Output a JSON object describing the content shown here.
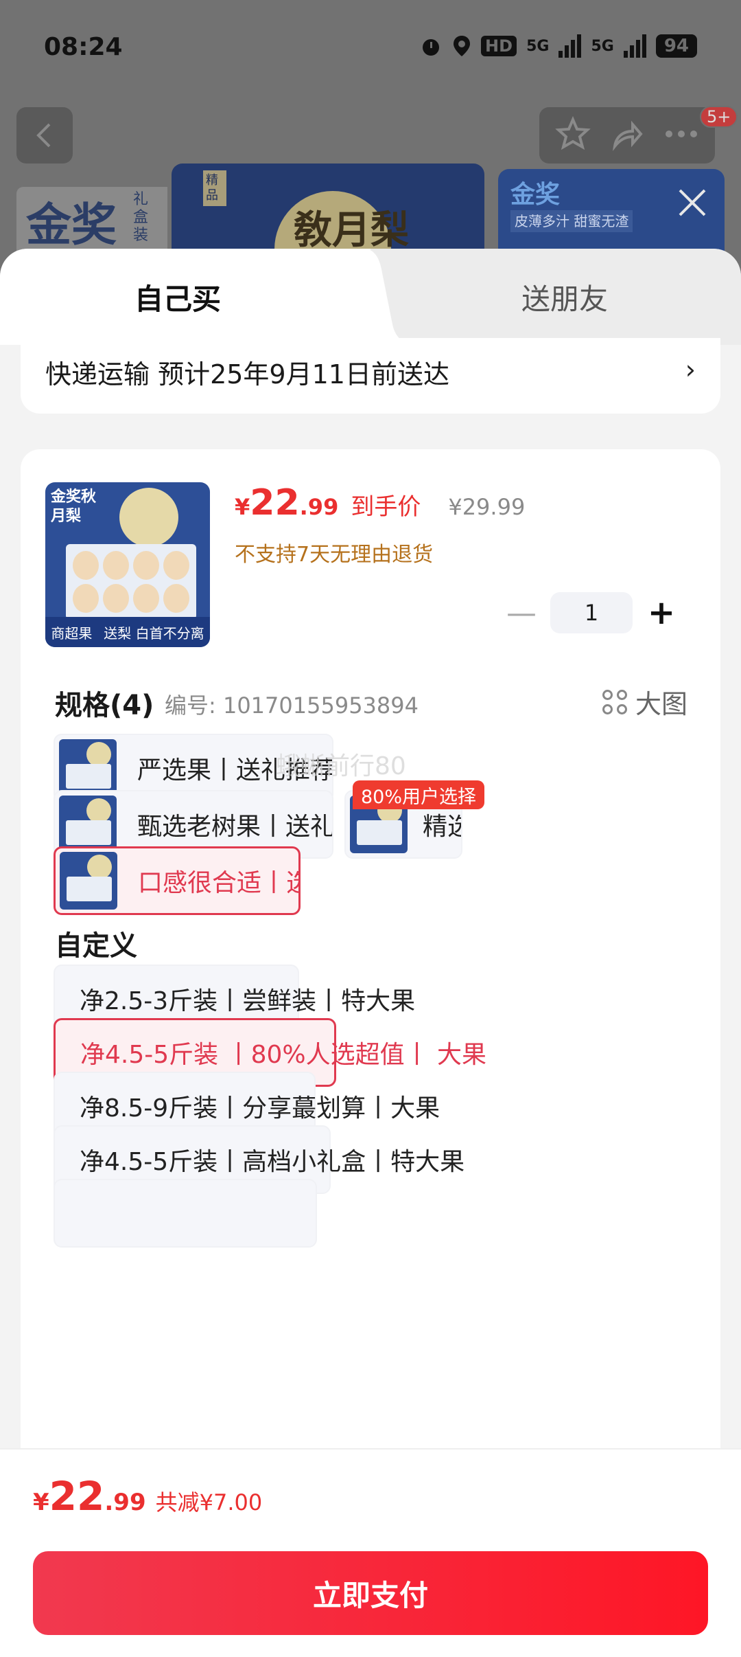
{
  "status_bar": {
    "time": "08:24",
    "hd": "HD",
    "net1": "5G",
    "net2": "5G",
    "battery": "94"
  },
  "header": {
    "badge": "5+"
  },
  "banner": {
    "left_title": "金奖",
    "left_sub": "礼盒装",
    "mid_title": "敎月梨",
    "mid_vert": "精品",
    "right_title": "金奖",
    "right_sub": "皮薄多汁 甜蜜无渣"
  },
  "tabs": [
    {
      "label": "自己买"
    },
    {
      "label": "送朋友"
    }
  ],
  "shipping": {
    "text": "快递运输 预计25年9月11日前送达",
    "arrow": "›"
  },
  "product": {
    "thumb_title": "金奖秋月梨",
    "thumb_bottom_left": "商超果",
    "thumb_bottom_right": "送梨 白首不分离",
    "currency": "¥",
    "price_int": "22",
    "price_dec": ".99",
    "price_label": "到手价",
    "original_price": "¥29.99",
    "return_policy": "不支持7天无理由退货",
    "quantity": "1",
    "minus": "—",
    "plus": "+"
  },
  "spec": {
    "title": "规格(4)",
    "code": "编号: 10170155953894",
    "bigpic": "大图",
    "watermark": "蛾蜥前行80",
    "popular_badge": "80%用户选择",
    "options": [
      {
        "label": "严选果丨送礼推荐礼盒装丨甜"
      },
      {
        "label": "甄选老树果丨送礼推荐礼盒装"
      },
      {
        "label": "精选果"
      },
      {
        "label": "口感很合适丨选购人最多"
      }
    ]
  },
  "custom": {
    "title": "自定义",
    "options": [
      {
        "label": "净2.5-3斤装丨尝鲜装丨特大果"
      },
      {
        "label": "净4.5-5斤装 丨80%人选超值丨 大果"
      },
      {
        "label": "净8.5-9斤装丨分享蕞划算丨大果"
      },
      {
        "label": "净4.5-5斤装丨高档小礼盒丨特大果"
      }
    ]
  },
  "footer": {
    "currency": "¥",
    "price_int": "22",
    "price_dec": ".99",
    "discount": "共减¥7.00",
    "pay_label": "立即支付"
  },
  "colors": {
    "accent": "#ea2f2f",
    "pay_start": "#f1394f",
    "pay_end": "#fe1626",
    "warning": "#b5711c"
  }
}
